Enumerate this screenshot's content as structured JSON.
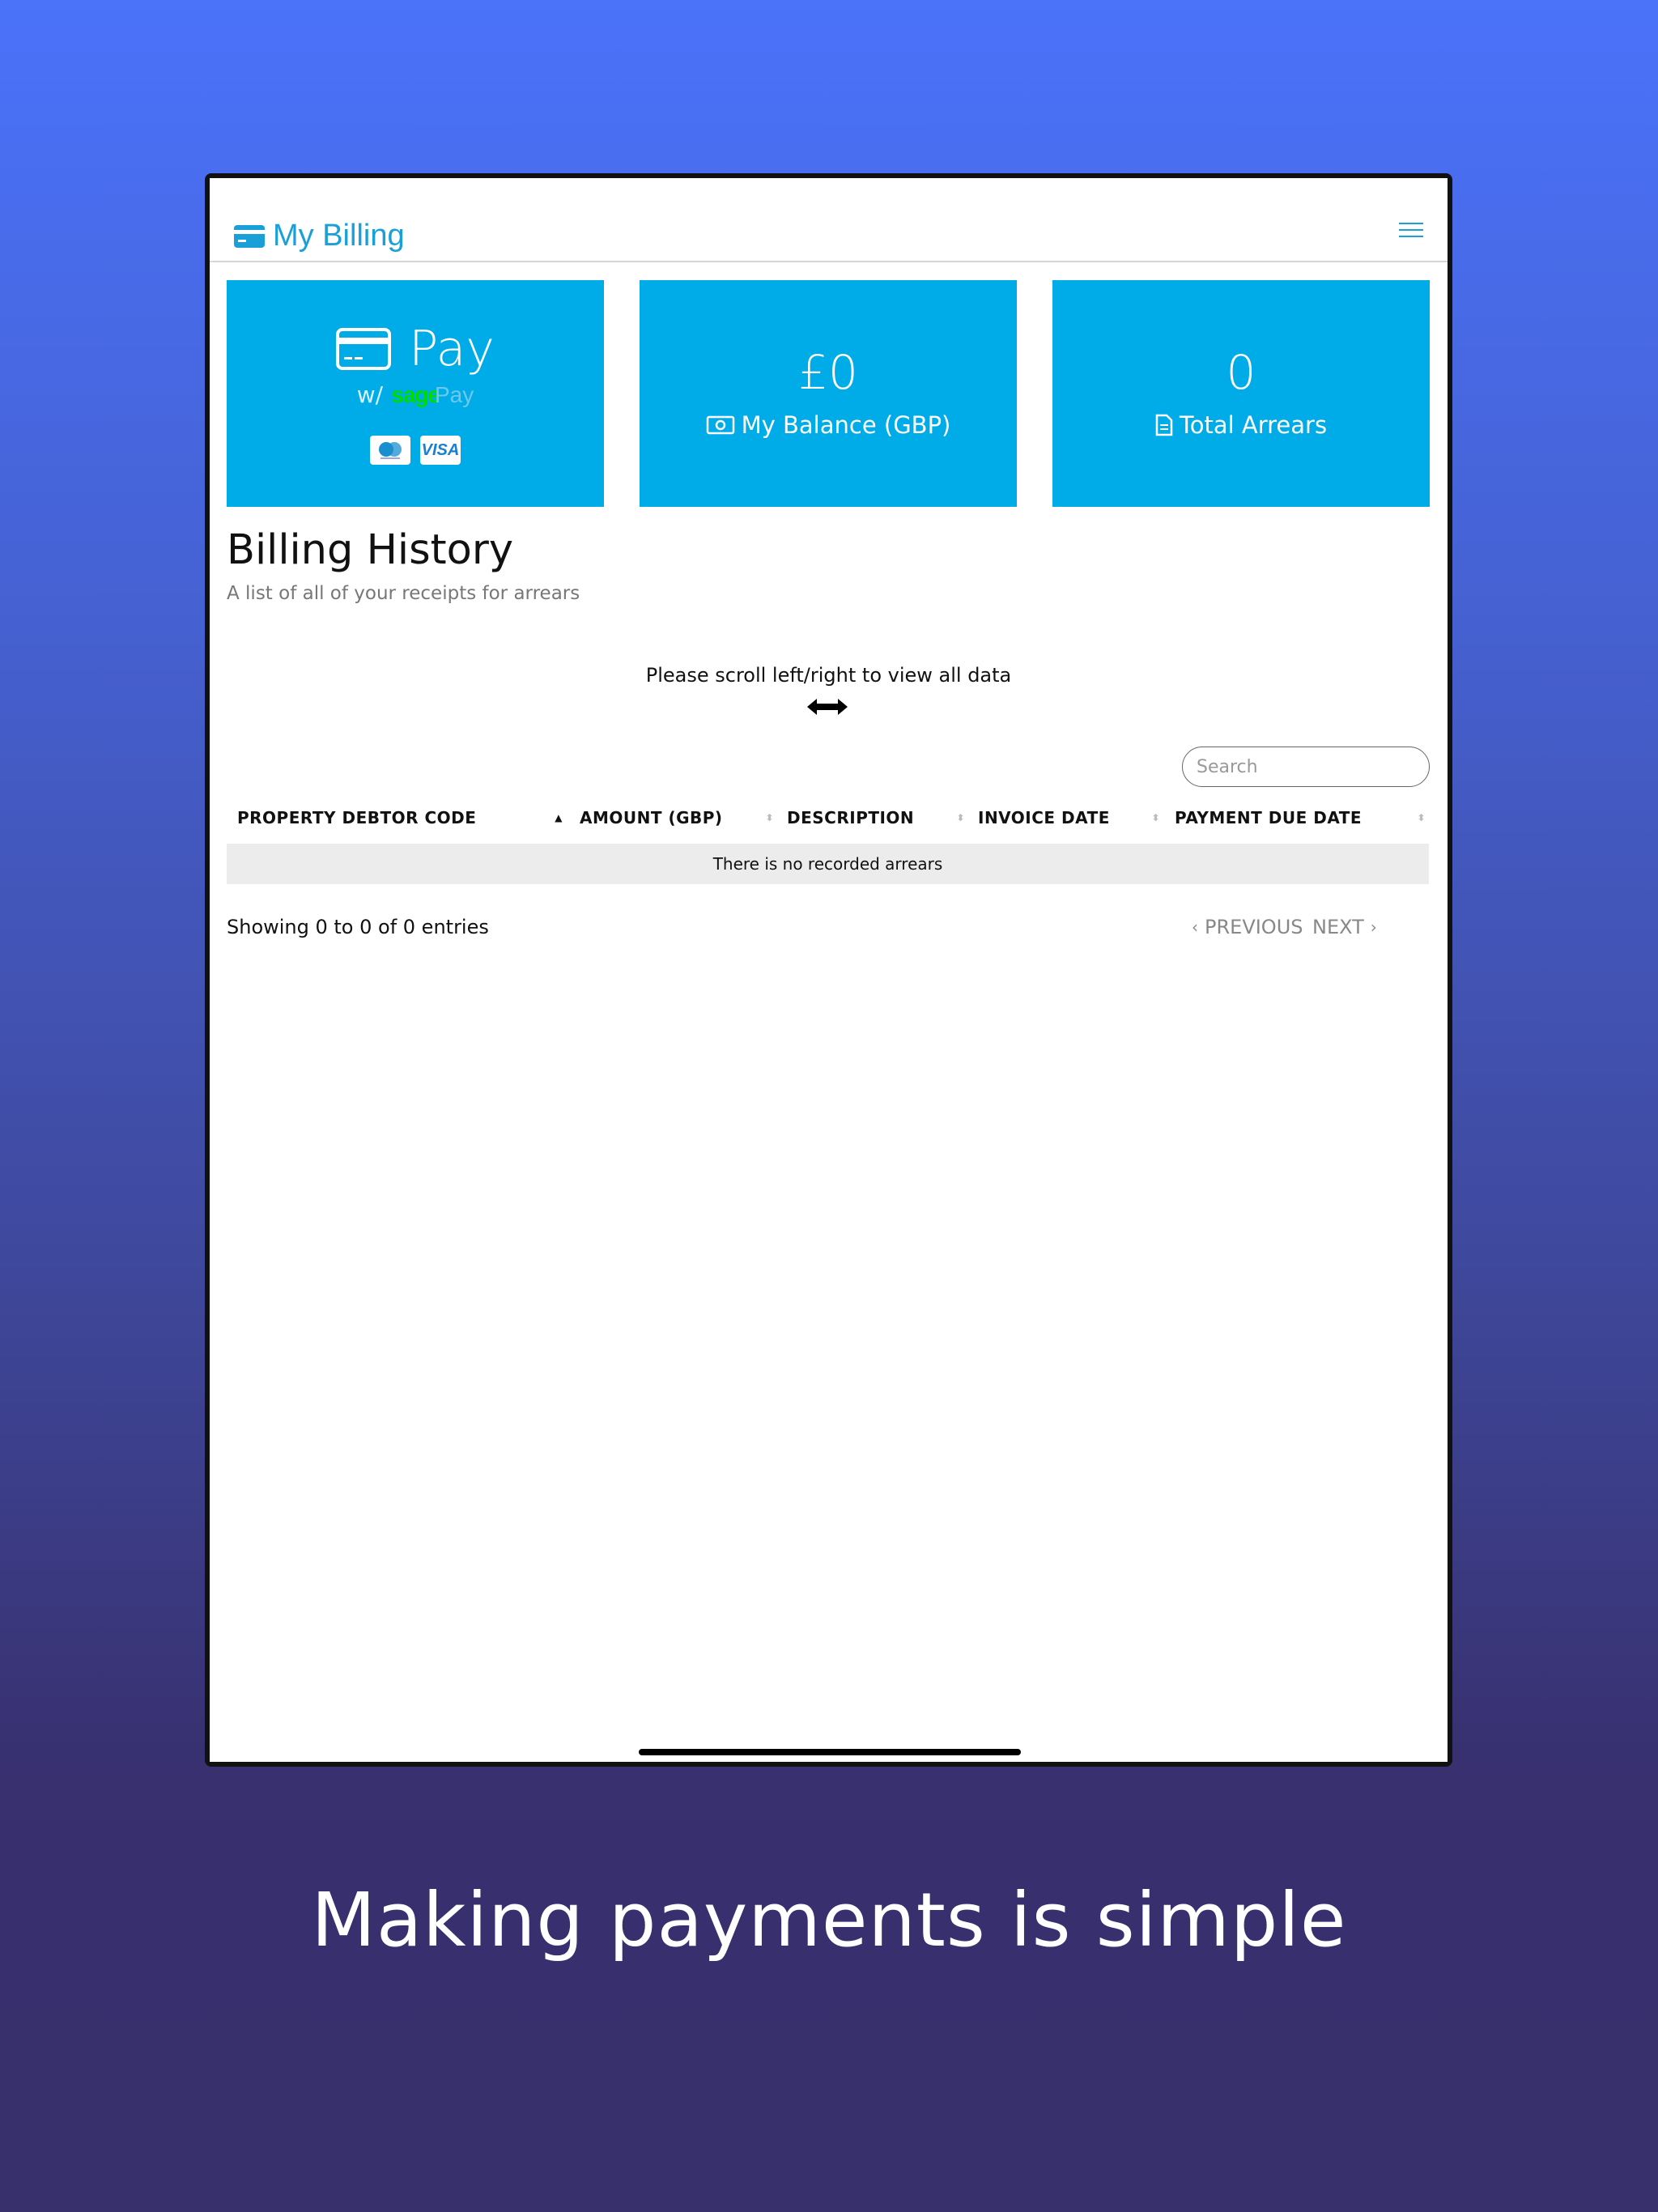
{
  "header": {
    "title": "My Billing"
  },
  "tiles": {
    "pay": {
      "label": "Pay",
      "with_prefix": "w/",
      "brand_sage": "sage",
      "brand_pay": "Pay",
      "visa": "VISA"
    },
    "balance": {
      "value": "£0",
      "label": "My Balance (GBP)"
    },
    "arrears": {
      "value": "0",
      "label": "Total Arrears"
    }
  },
  "billing": {
    "title": "Billing History",
    "subtitle": "A list of all of your receipts for arrears",
    "scroll_hint": "Please scroll left/right to view all data",
    "search_placeholder": "Search",
    "columns": [
      "PROPERTY DEBTOR CODE",
      "AMOUNT (GBP)",
      "DESCRIPTION",
      "INVOICE DATE",
      "PAYMENT DUE DATE"
    ],
    "empty_message": "There is no recorded arrears",
    "info": "Showing 0 to 0 of 0 entries",
    "prev_label": "PREVIOUS",
    "next_label": "NEXT"
  },
  "caption": "Making payments is simple",
  "colors": {
    "accent": "#00ace8",
    "brand_blue": "#1aa0d8",
    "sage_green": "#00dc00"
  }
}
